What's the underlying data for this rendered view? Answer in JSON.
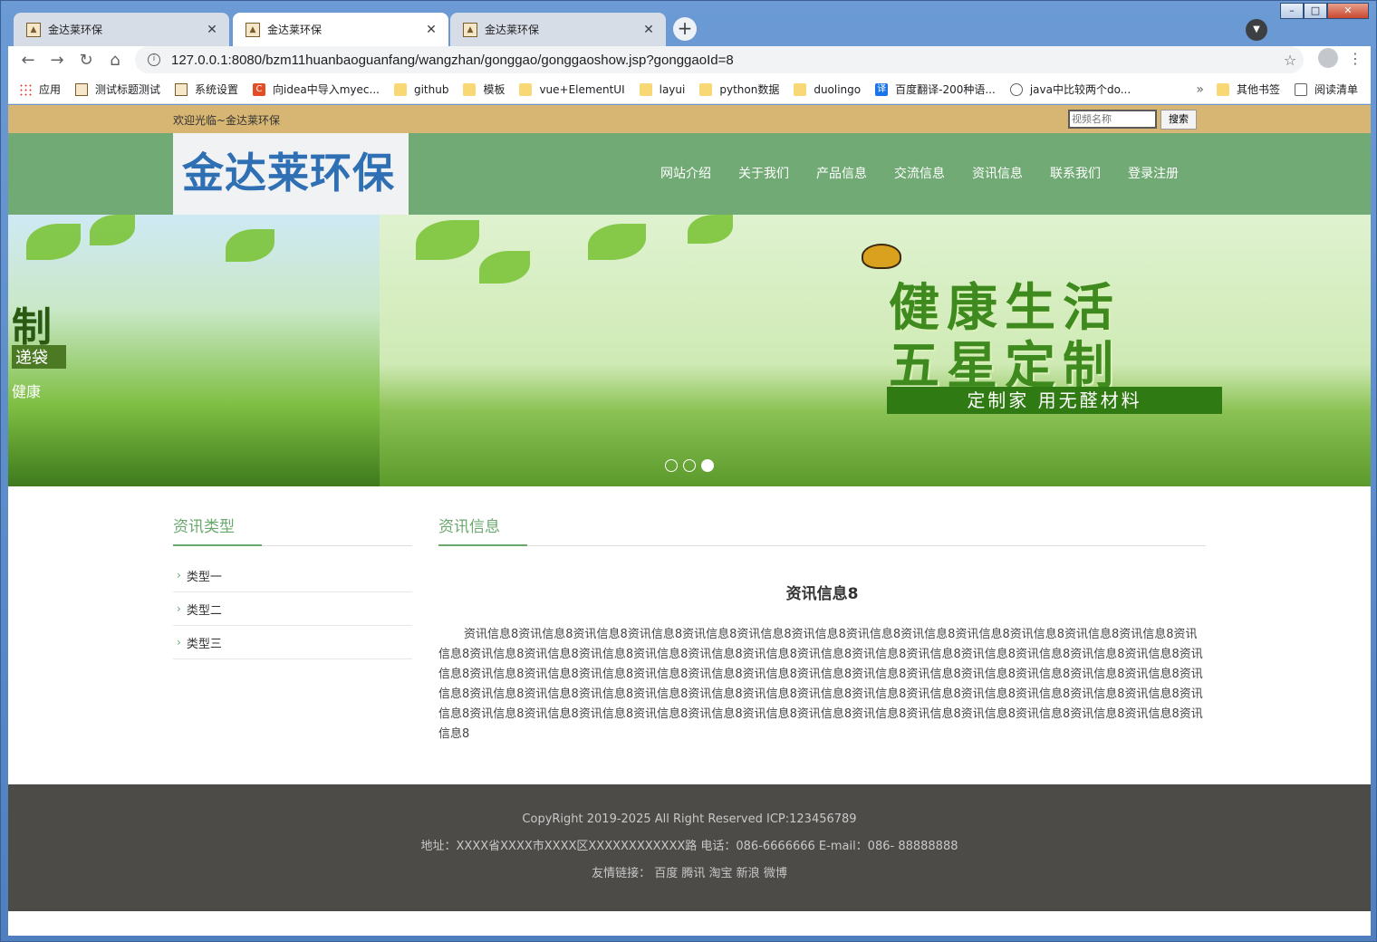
{
  "browser": {
    "tabs": [
      {
        "title": "金达莱环保"
      },
      {
        "title": "金达莱环保"
      },
      {
        "title": "金达莱环保"
      }
    ],
    "url": "127.0.0.1:8080/bzm11huanbaoguanfang/wangzhan/gonggao/gonggaoshow.jsp?gonggaoId=8",
    "bookmarks": [
      {
        "label": "应用",
        "icon": "apps-icon"
      },
      {
        "label": "测试标题测试",
        "icon": "site-icon"
      },
      {
        "label": "系统设置",
        "icon": "site-icon"
      },
      {
        "label": "向idea中导入myec...",
        "icon": "c-icon"
      },
      {
        "label": "github",
        "icon": "folder-icon"
      },
      {
        "label": "模板",
        "icon": "folder-icon"
      },
      {
        "label": "vue+ElementUI",
        "icon": "folder-icon"
      },
      {
        "label": "layui",
        "icon": "folder-icon"
      },
      {
        "label": "python数据",
        "icon": "folder-icon"
      },
      {
        "label": "duolingo",
        "icon": "folder-icon"
      },
      {
        "label": "百度翻译-200种语...",
        "icon": "translate-icon"
      },
      {
        "label": "java中比较两个do...",
        "icon": "link-icon"
      }
    ],
    "bookmarks_overflow": "»",
    "other_bookmarks": "其他书签",
    "reading_list": "阅读清单"
  },
  "site": {
    "welcome": "欢迎光临~金达莱环保",
    "search_placeholder": "视频名称",
    "search_button": "搜索",
    "logo": "金达莱环保",
    "nav": [
      "网站介绍",
      "关于我们",
      "产品信息",
      "交流信息",
      "资讯信息",
      "联系我们",
      "登录注册"
    ]
  },
  "banner": {
    "left_text1": "制",
    "left_text2": "递袋",
    "left_text3": "健康",
    "slogan1": "健康生活",
    "slogan2": "五星定制",
    "slogan3": "定制家 用无醛材料",
    "slide_count": 3,
    "active_slide": 3
  },
  "sidebar": {
    "title": "资讯类型",
    "items": [
      "类型一",
      "类型二",
      "类型三"
    ]
  },
  "main": {
    "title": "资讯信息",
    "article_title": "资讯信息8",
    "article_body": "资讯信息8资讯信息8资讯信息8资讯信息8资讯信息8资讯信息8资讯信息8资讯信息8资讯信息8资讯信息8资讯信息8资讯信息8资讯信息8资讯信息8资讯信息8资讯信息8资讯信息8资讯信息8资讯信息8资讯信息8资讯信息8资讯信息8资讯信息8资讯信息8资讯信息8资讯信息8资讯信息8资讯信息8资讯信息8资讯信息8资讯信息8资讯信息8资讯信息8资讯信息8资讯信息8资讯信息8资讯信息8资讯信息8资讯信息8资讯信息8资讯信息8资讯信息8资讯信息8资讯信息8资讯信息8资讯信息8资讯信息8资讯信息8资讯信息8资讯信息8资讯信息8资讯信息8资讯信息8资讯信息8资讯信息8资讯信息8资讯信息8资讯信息8资讯信息8资讯信息8资讯信息8资讯信息8资讯信息8资讯信息8资讯信息8资讯信息8资讯信息8资讯信息8资讯信息8资讯信息8"
  },
  "footer": {
    "copyright": "CopyRight 2019-2025 All Right Reserved  ICP:123456789",
    "address": "地址：XXXX省XXXX市XXXX区XXXXXXXXXXXX路  电话：086-6666666  E-mail：086- 88888888",
    "links": "友情链接：  百度 腾讯 淘宝 新浪 微博"
  },
  "colors": {
    "topbar": "#d7b573",
    "header": "#71aa74",
    "logo": "#2f6fb4",
    "accent": "#6aa86d",
    "footer": "#4c4b48"
  }
}
